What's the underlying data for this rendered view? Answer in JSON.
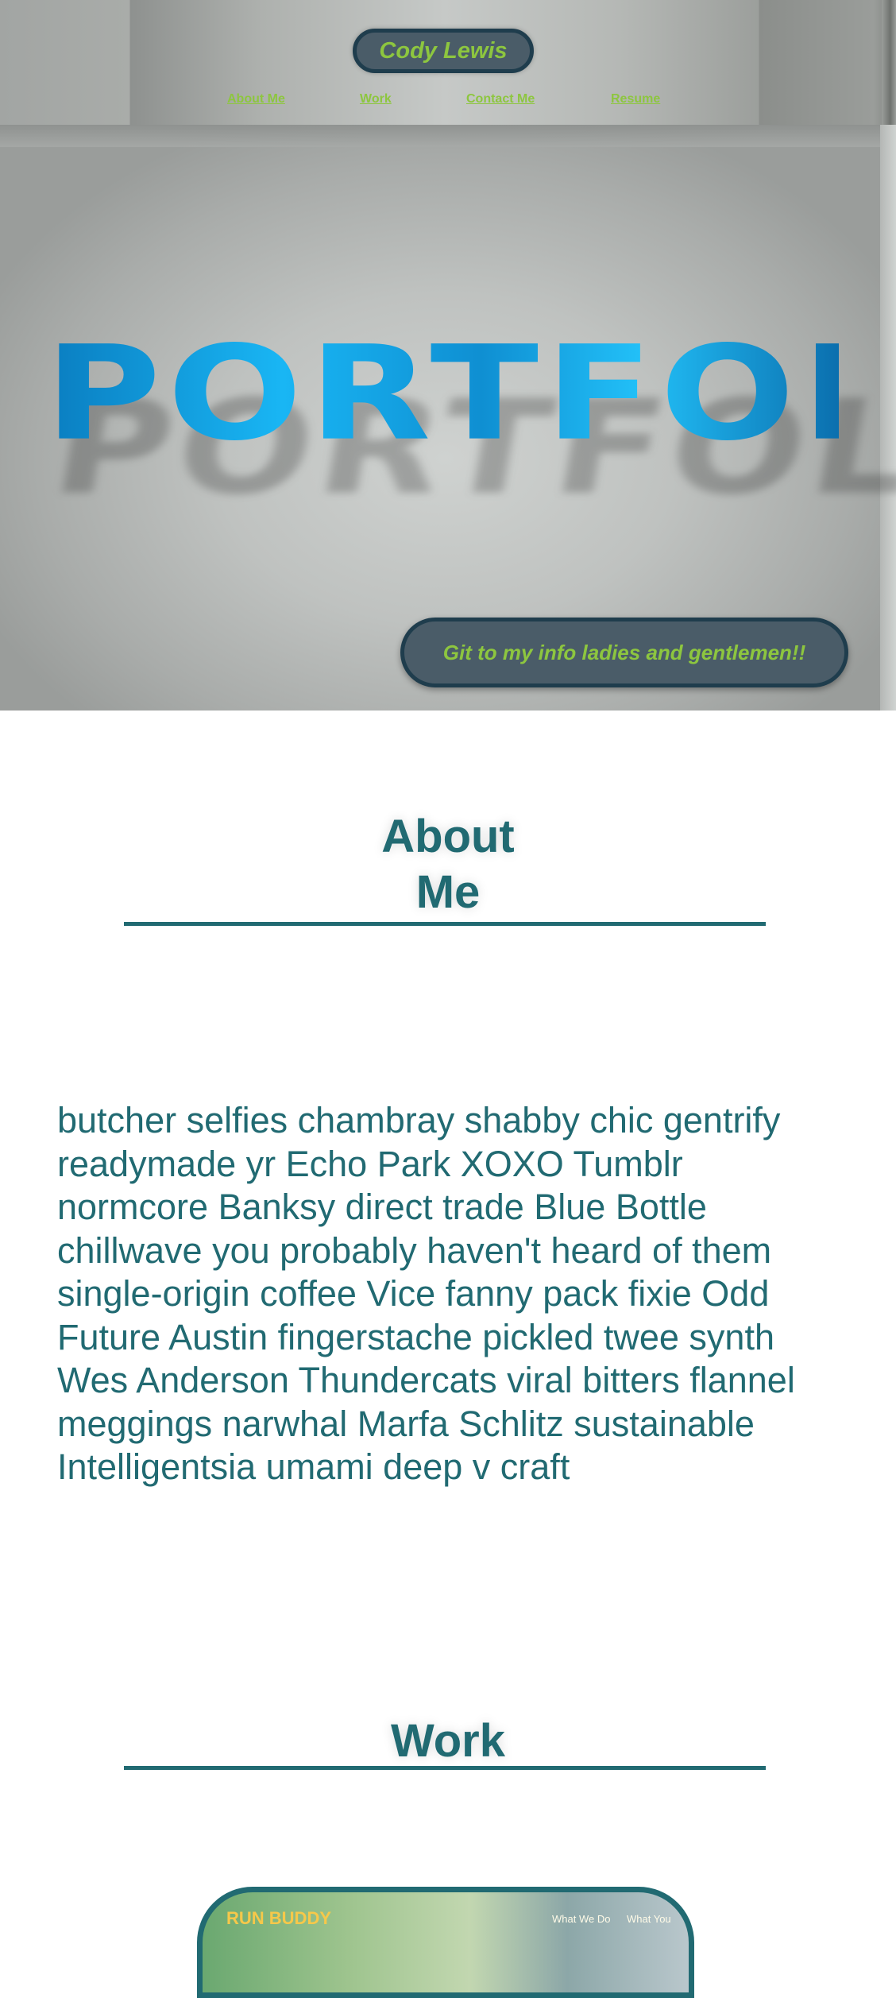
{
  "header": {
    "name": "Cody Lewis",
    "nav": [
      "About Me",
      "Work",
      "Contact Me",
      "Resume"
    ]
  },
  "hero": {
    "word": "PORTFOLIO",
    "cta": "Git to my info ladies and gentlemen!!"
  },
  "about": {
    "title": "About Me",
    "body": "butcher selfies chambray shabby chic gentrify readymade yr Echo Park XOXO Tumblr normcore Banksy direct trade Blue Bottle chillwave you probably haven't heard of them single-origin coffee Vice fanny pack fixie Odd Future Austin fingerstache pickled twee synth Wes Anderson Thundercats viral bitters flannel meggings narwhal Marfa Schlitz sustainable Intelligentsia umami deep v craft"
  },
  "work": {
    "title": "Work",
    "project": {
      "brand": "RUN BUDDY",
      "nav": [
        "What We Do",
        "What You"
      ]
    }
  },
  "colors": {
    "accent_green": "#8dc63f",
    "teal": "#216a72",
    "pill_bg": "#4a5c68"
  }
}
